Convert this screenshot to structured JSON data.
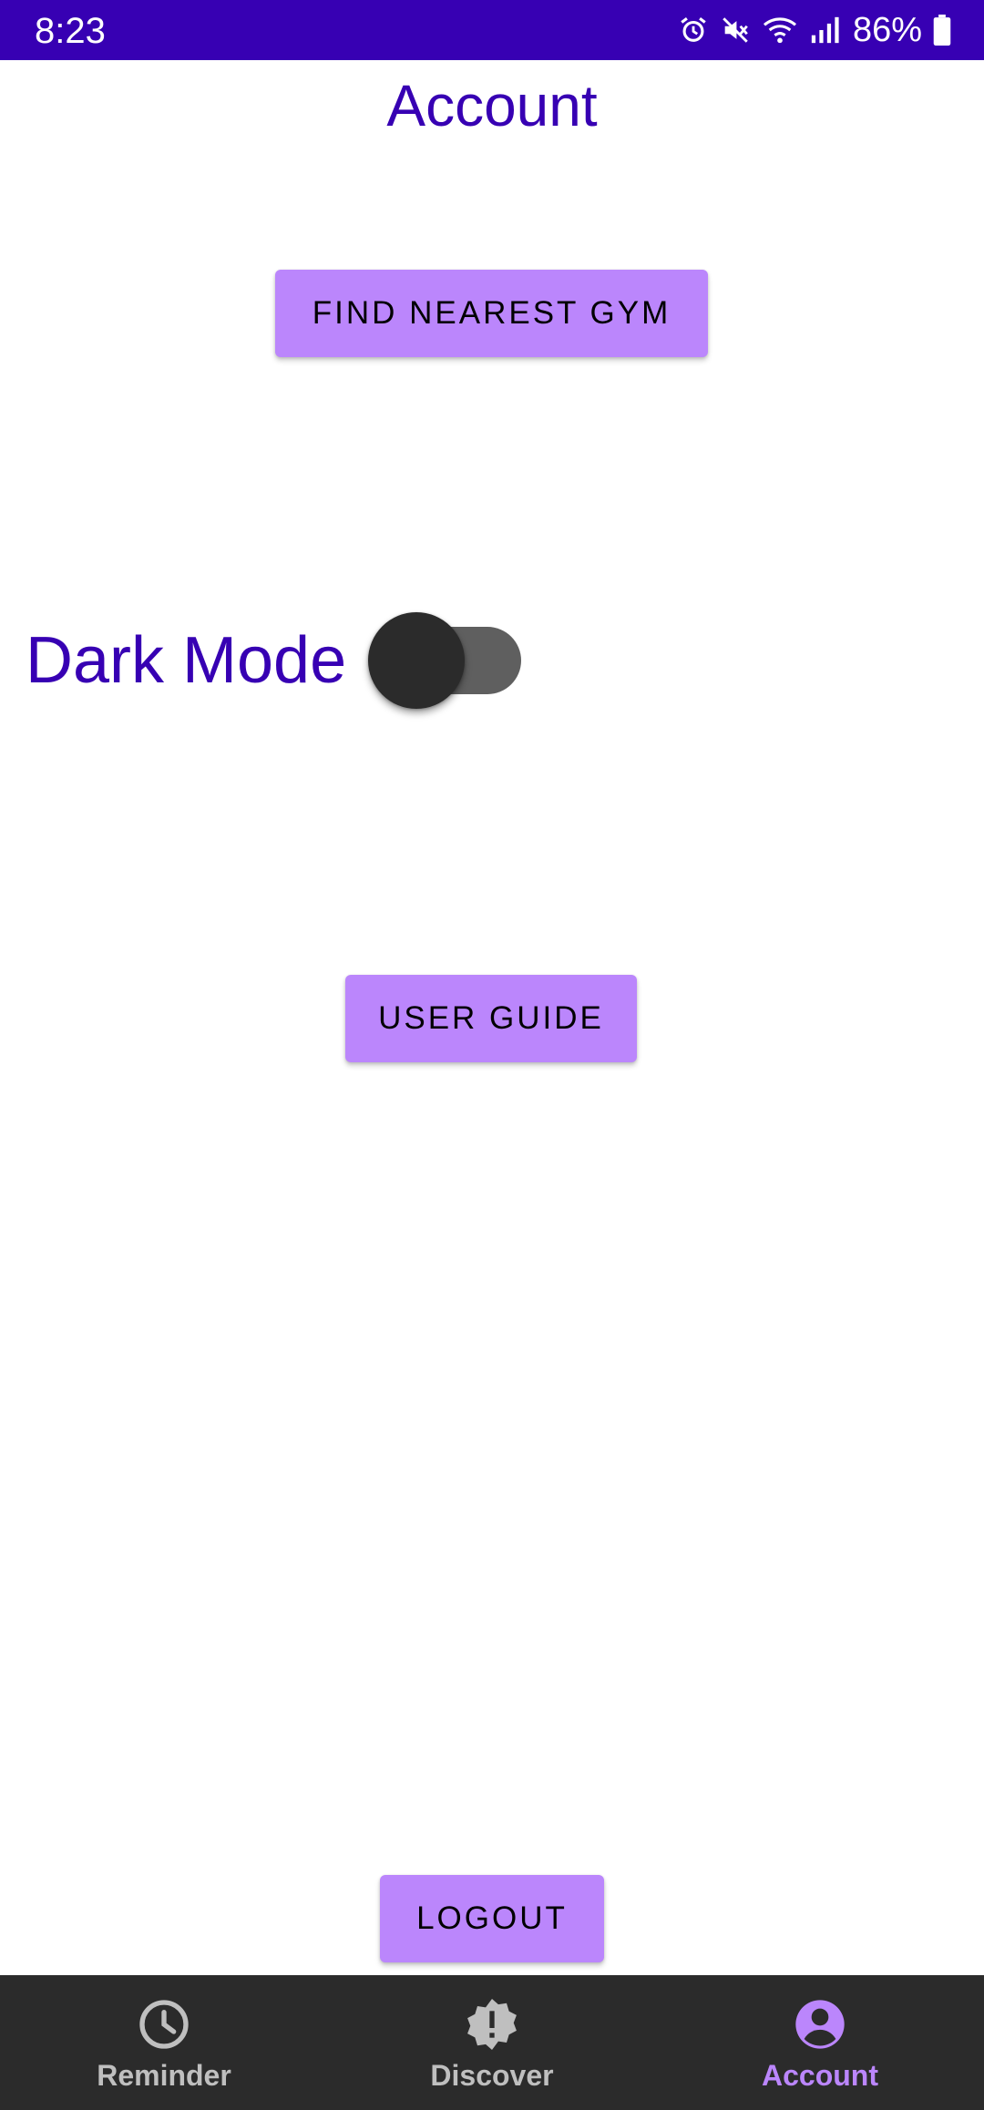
{
  "status_bar": {
    "time": "8:23",
    "battery": "86%",
    "icons": [
      "alarm-icon",
      "mute-icon",
      "wifi-icon",
      "signal-icon",
      "battery-icon"
    ],
    "background": "#3700B3"
  },
  "page": {
    "title": "Account"
  },
  "actions": {
    "find_gym_label": "FIND NEAREST GYM",
    "user_guide_label": "USER GUIDE",
    "logout_label": "LOGOUT"
  },
  "settings": {
    "dark_mode_label": "Dark Mode",
    "dark_mode_enabled": false
  },
  "bottom_nav": {
    "items": [
      {
        "label": "Reminder",
        "icon": "clock-icon",
        "active": false
      },
      {
        "label": "Discover",
        "icon": "alert-badge-icon",
        "active": false
      },
      {
        "label": "Account",
        "icon": "account-circle-icon",
        "active": true
      }
    ]
  },
  "colors": {
    "primary_dark": "#3700B3",
    "accent": "#BB86FC",
    "nav_background": "#2B2B2B",
    "nav_inactive": "#BFBFBF"
  }
}
